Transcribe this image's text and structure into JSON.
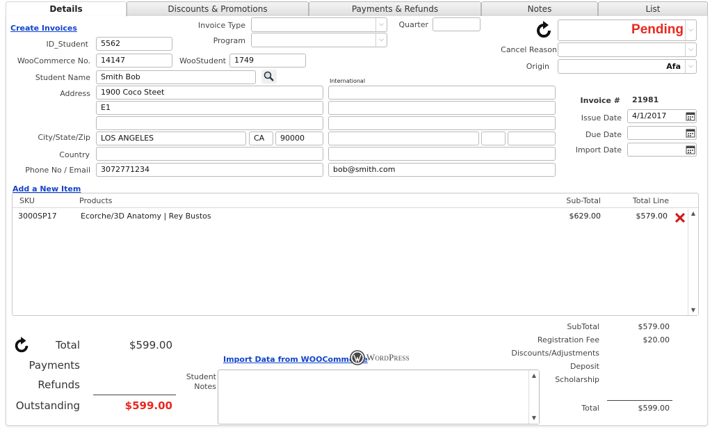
{
  "tabs": [
    {
      "label": "Details"
    },
    {
      "label": "Discounts & Promotions"
    },
    {
      "label": "Payments & Refunds"
    },
    {
      "label": "Notes"
    },
    {
      "label": "List"
    }
  ],
  "header": {
    "create_invoices_link": "Create Invoices",
    "invoice_type_label": "Invoice Type",
    "invoice_type_value": "",
    "program_label": "Program",
    "program_value": "",
    "quarter_label": "Quarter",
    "quarter_value": "",
    "status_value": "Pending",
    "status_color": "#e8281e",
    "cancel_reason_label": "Cancel Reason",
    "cancel_reason_value": "",
    "origin_label": "Origin",
    "origin_value": "Afa"
  },
  "student": {
    "id_label": "ID_Student",
    "id_value": "5562",
    "woo_no_label": "WooCommerce No.",
    "woo_no_value": "14147",
    "woo_student_label": "WooStudent",
    "woo_student_value": "1749",
    "name_label": "Student Name",
    "name_value": "Smith Bob",
    "address_label": "Address",
    "address_1": "1900 Coco Steet",
    "address_2": "E1",
    "address_3": "",
    "international_label": "International",
    "intl_1": "",
    "intl_2": "",
    "intl_3": "",
    "city_label": "City/State/Zip",
    "city_value": "LOS ANGELES",
    "state_value": "CA",
    "zip_value": "90000",
    "intl_city": "",
    "intl_state": "",
    "intl_zip": "",
    "country_label": "Country",
    "country_value": "",
    "intl_country": "",
    "phone_label": "Phone No / Email",
    "phone_value": "3072771234",
    "email_value": "bob@smith.com"
  },
  "invoice": {
    "number_label": "Invoice #",
    "number_value": "21981",
    "issue_date_label": "Issue Date",
    "issue_date_value": "4/1/2017",
    "due_date_label": "Due Date",
    "due_date_value": "",
    "import_date_label": "Import Date",
    "import_date_value": ""
  },
  "items": {
    "add_link": "Add a New Item",
    "columns": {
      "sku": "SKU",
      "products": "Products",
      "subtotal": "Sub-Total",
      "total_line": "Total Line"
    },
    "rows": [
      {
        "sku": "3000SP17",
        "product": "Ecorche/3D Anatomy | Rey Bustos",
        "subtotal": "$629.00",
        "total_line": "$579.00"
      }
    ]
  },
  "totals": {
    "total_label": "Total",
    "total_value": "$599.00",
    "payments_label": "Payments",
    "payments_value": "",
    "refunds_label": "Refunds",
    "refunds_value": "",
    "outstanding_label": "Outstanding",
    "outstanding_value": "$599.00",
    "outstanding_color": "#e8281e"
  },
  "import": {
    "link": "Import Data from WOOCommerce",
    "logo_text": "WordPress"
  },
  "notes": {
    "label_line1": "Student",
    "label_line2": "Notes",
    "value": ""
  },
  "summary": {
    "subtotal_label": "SubTotal",
    "subtotal_value": "$579.00",
    "registration_label": "Registration Fee",
    "registration_value": "$20.00",
    "discounts_label": "Discounts/Adjustments",
    "discounts_value": "",
    "deposit_label": "Deposit",
    "deposit_value": "",
    "scholarship_label": "Scholarship",
    "scholarship_value": "",
    "total_label": "Total",
    "total_value": "$599.00"
  }
}
